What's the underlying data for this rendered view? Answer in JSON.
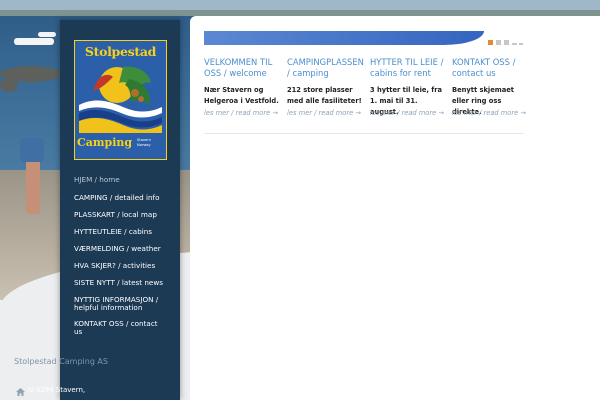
{
  "logo": {
    "title": "Stolpestad",
    "subtitle": "Camping",
    "small_text": "Stavern Norway"
  },
  "nav": {
    "items": [
      {
        "label": "HJEM / home"
      },
      {
        "label": "CAMPING / detailed info"
      },
      {
        "label": "PLASSKART / local map"
      },
      {
        "label": "HYTTEUTLEIE / cabins"
      },
      {
        "label": "VÆRMELDING / weather"
      },
      {
        "label": "HVA SKJER? / activities"
      },
      {
        "label": "SISTE NYTT / latest news"
      },
      {
        "label": "NYTTIG INFORMASJON / helpful information"
      },
      {
        "label": "KONTAKT OSS / contact us"
      }
    ]
  },
  "footer": {
    "company": "Stolpestad Camping AS",
    "address": "N-3294 Stavern,"
  },
  "columns": [
    {
      "title": "VELKOMMEN TIL OSS / welcome",
      "text": "Nær Stavern og Helgeroa i Vestfold.",
      "link": "les mer / read more →"
    },
    {
      "title": "CAMPINGPLASSEN / camping",
      "text": "212 store plasser med alle fasiliteter!",
      "link": "les mer / read more →"
    },
    {
      "title": "HYTTER TIL LEIE / cabins for rent",
      "text": "3 hytter til leie, fra 1. mai til 31. august.",
      "link": "les mer / read more →"
    },
    {
      "title": "KONTAKT OSS / contact us",
      "text": "Benytt skjemaet eller ring oss direkte.",
      "link": "les mer / read more →"
    }
  ],
  "colors": {
    "sidebar": "#1d3a55",
    "accent_blue": "#4a8fd0",
    "slider_dot_active": "#e98a30"
  }
}
